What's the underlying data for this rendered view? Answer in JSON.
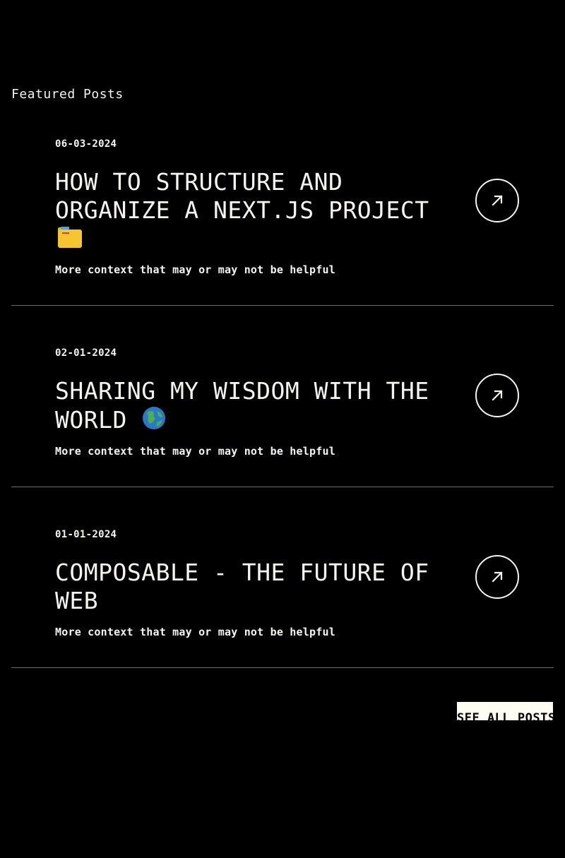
{
  "section_title": "Featured Posts",
  "colors": {
    "background": "#000000",
    "text": "#f5f5ee",
    "divider": "#6b6b6b",
    "button_bg": "#fdfdf2"
  },
  "posts": [
    {
      "date": "06-03-2024",
      "title": "HOW TO STRUCTURE AND ORGANIZE A NEXT.JS PROJECT",
      "emoji": "folder-icon",
      "subtitle": "More context that may or may not be helpful",
      "link_icon": "arrow-up-right-icon"
    },
    {
      "date": "02-01-2024",
      "title": "SHARING MY WISDOM WITH THE WORLD",
      "emoji": "globe-icon",
      "subtitle": "More context that may or may not be helpful",
      "link_icon": "arrow-up-right-icon"
    },
    {
      "date": "01-01-2024",
      "title": "COMPOSABLE - THE FUTURE OF WEB",
      "emoji": "",
      "subtitle": "More context that may or may not be helpful",
      "link_icon": "arrow-up-right-icon"
    }
  ],
  "see_all_label": "SEE ALL POSTS"
}
